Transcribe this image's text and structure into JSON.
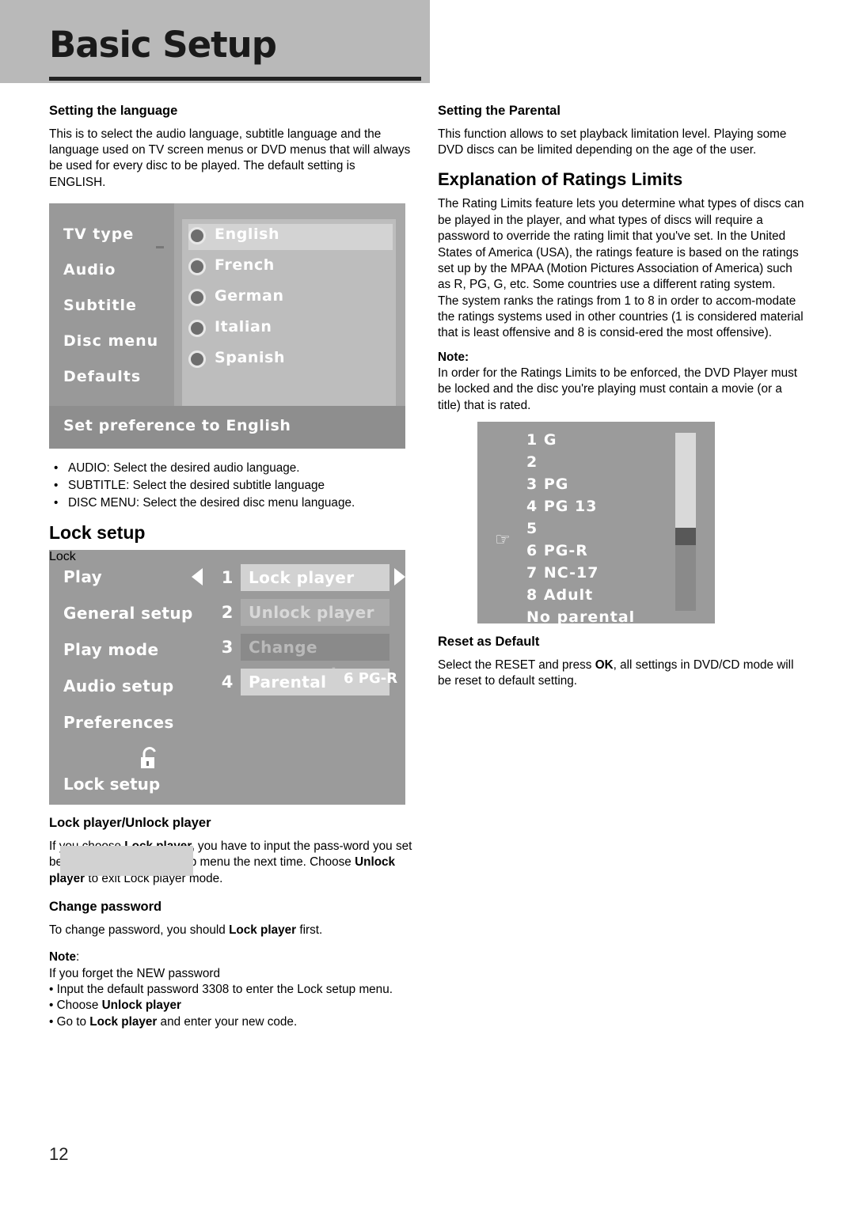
{
  "header": {
    "title": "Basic Setup"
  },
  "left": {
    "lang_heading": "Setting the language",
    "lang_para": "This is to select the audio language, subtitle language and the language used on TV screen menus or DVD menus that will always be used for every disc to be played. The default setting is ENGLISH.",
    "lang_menu": {
      "items": [
        "TV type",
        "Audio",
        "Subtitle",
        "Disc menu",
        "Defaults"
      ],
      "options": [
        "English",
        "French",
        "German",
        "Italian",
        "Spanish"
      ],
      "selected": "English",
      "footer": "Set preference to English"
    },
    "bullets": [
      "AUDIO: Select the desired audio language.",
      "SUBTITLE: Select the desired subtitle language",
      "DISC MENU: Select the desired disc menu language."
    ],
    "lock_heading": "Lock setup",
    "lock_menu": {
      "items": [
        "Play",
        "General setup",
        "Play mode",
        "Audio setup",
        "Preferences",
        "Lock"
      ],
      "rows": [
        {
          "num": "1",
          "label": "Lock player"
        },
        {
          "num": "2",
          "label": "Unlock player"
        },
        {
          "num": "3",
          "label": "Change password"
        },
        {
          "num": "4",
          "label": "Parental"
        }
      ],
      "rating_badge": "6 PG-R",
      "footer": "Lock setup"
    },
    "lock_player_heading": "Lock player/Unlock player",
    "lock_player_para_1": "If you choose ",
    "lock_player_bold_1": "Lock player,",
    "lock_player_para_2": " you have to input the pass-word you set before enter the Lock setup menu the next time. Choose ",
    "lock_player_bold_2": "Unlock player",
    "lock_player_para_3": " to exit Lock player mode.",
    "change_pw_heading": "Change password",
    "change_pw_para_1": "To change password, you should ",
    "change_pw_bold": "Lock player",
    "change_pw_para_2": " first.",
    "note_label": "Note",
    "note_colon": ":",
    "note_line1": "If you forget the NEW password",
    "note_line2": "• Input the default password 3308 to enter the Lock setup menu.",
    "note_line3_pre": "• Choose ",
    "note_line3_bold": "Unlock player",
    "note_line4_pre": "• Go to ",
    "note_line4_bold": "Lock player",
    "note_line4_post": " and enter your new code."
  },
  "right": {
    "parental_heading": "Setting the Parental",
    "parental_para": "This function allows to set playback limitation level. Playing some DVD discs can be limited depending on the age of the user.",
    "ratings_heading": "Explanation of Ratings Limits",
    "ratings_para_1": "The Rating Limits feature lets you determine what types of discs can be played in the player, and what types of discs will require a password to override the rating limit that you've set. In the United States of America (USA), the ratings feature is based on the ratings set up by the MPAA (Motion Pictures Association of America) such as R, PG, G, etc. Some countries use a different rating system.",
    "ratings_para_2": "The system ranks the ratings from 1 to 8 in order to accom-modate the ratings systems used in other countries (1 is considered material that is least offensive and 8 is consid-ered the most offensive).",
    "note_label": "Note:",
    "note_para": "In order for the Ratings Limits to be enforced, the DVD Player must be locked and the disc you're playing must contain a movie (or a title) that is rated.",
    "ratings_menu": {
      "items": [
        "1 G",
        "2",
        "3 PG",
        "4 PG 13",
        "5",
        "6 PG-R",
        "7 NC-17",
        "8 Adult",
        "No parental"
      ],
      "pointer_at": "6 PG-R"
    },
    "reset_heading": "Reset as Default",
    "reset_para_1": "Select the RESET and press ",
    "reset_bold": "OK",
    "reset_para_2": ", all settings in DVD/CD mode will be reset to default setting."
  },
  "page_number": "12"
}
